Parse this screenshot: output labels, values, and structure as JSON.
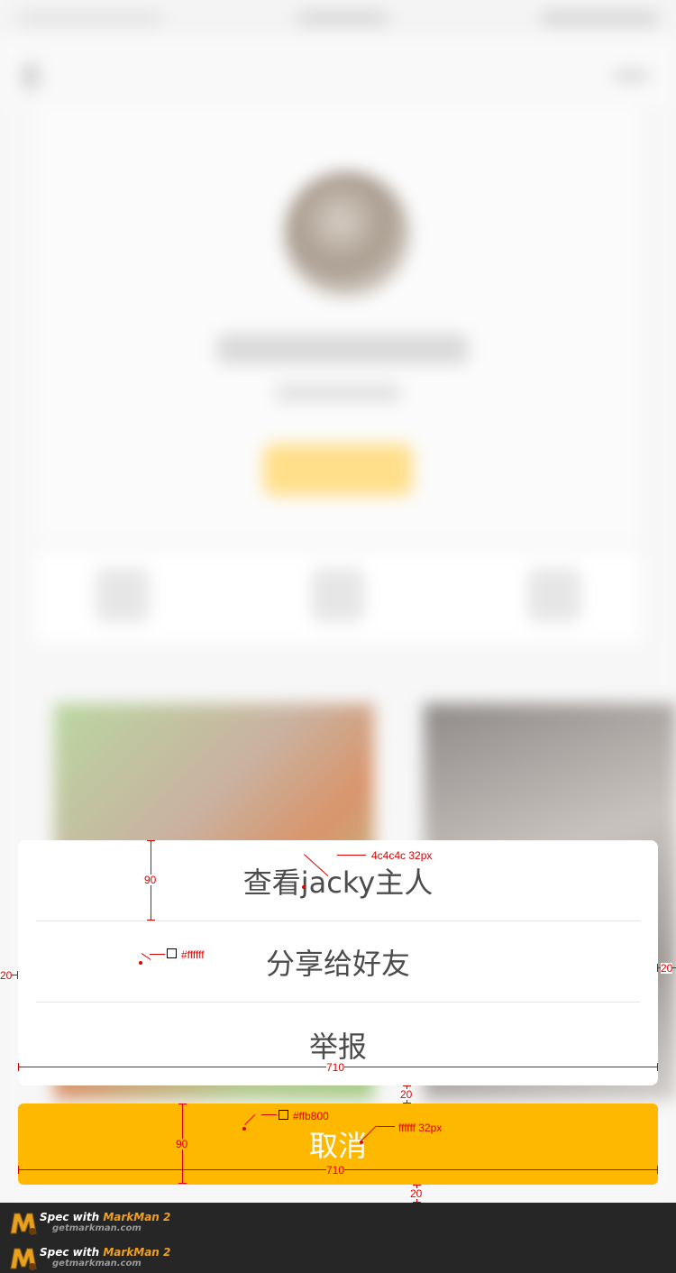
{
  "action_sheet": {
    "items": [
      {
        "label": "查看jacky主人"
      },
      {
        "label": "分享给好友"
      },
      {
        "label": "举报"
      }
    ],
    "cancel_label": "取消"
  },
  "colors": {
    "sheet_bg": "#ffffff",
    "item_text": "#4c4c4c",
    "cancel_bg": "#ffb800",
    "cancel_text": "#ffffff"
  },
  "spec_annotations": {
    "item_text_spec": "4c4c4c   32px",
    "sheet_bg_spec": "#ffffff",
    "item_height": "90",
    "left_margin": "20",
    "right_margin": "20",
    "sheet_width": "710",
    "gap": "20",
    "cancel_bg_spec": "#ffb800",
    "cancel_text_spec": "ffffff   32px",
    "cancel_height": "90",
    "cancel_width": "710",
    "bottom_gap": "20"
  },
  "footer": {
    "rows": [
      {
        "spec_with": "Spec with ",
        "brand": "MarkMan 2",
        "url": "getmarkman.com"
      },
      {
        "spec_with": "Spec with ",
        "brand": "MarkMan 2",
        "url": "getmarkman.com"
      }
    ]
  }
}
